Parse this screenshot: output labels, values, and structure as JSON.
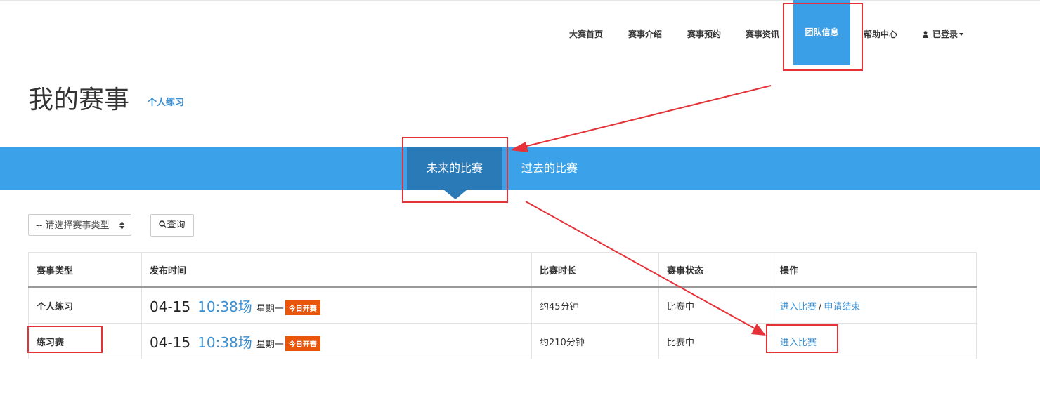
{
  "nav": {
    "items": [
      "大赛首页",
      "赛事介绍",
      "赛事预约",
      "赛事资讯"
    ],
    "active": "团队信息",
    "help": "帮助中心",
    "user": "已登录"
  },
  "header": {
    "title": "我的赛事",
    "sublink": "个人练习"
  },
  "tabs": {
    "active": "未来的比赛",
    "inactive": "过去的比赛"
  },
  "filter": {
    "select_value": "-- 请选择赛事类型",
    "query_label": "查询"
  },
  "table": {
    "headers": [
      "赛事类型",
      "发布时间",
      "比赛时长",
      "赛事状态",
      "操作"
    ],
    "rows": [
      {
        "type": "个人练习",
        "date": "04-15",
        "time": "10:38场",
        "weekday": "星期一",
        "badge": "今日开赛",
        "duration": "约45分钟",
        "status": "比赛中",
        "op_primary": "进入比赛",
        "op_separator": "/",
        "op_secondary": "申请结束"
      },
      {
        "type": "练习赛",
        "date": "04-15",
        "time": "10:38场",
        "weekday": "星期一",
        "badge": "今日开赛",
        "duration": "约210分钟",
        "status": "比赛中",
        "op_primary": "进入比赛"
      }
    ]
  },
  "colors": {
    "accent": "#3ba2ea",
    "tab_active": "#2a7ab8",
    "link": "#3a8fd2",
    "badge": "#e8560b",
    "highlight": "#e53238"
  },
  "icons": [
    "user-icon",
    "caret-down-icon",
    "search-icon",
    "sort-arrows-icon"
  ]
}
